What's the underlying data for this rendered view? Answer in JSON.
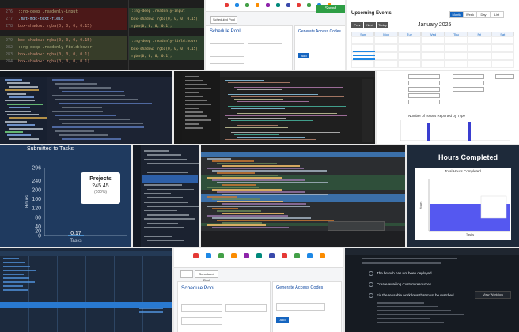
{
  "tile1": {
    "lines": [
      {
        "num": "276",
        "code": "  ::ng-deep .readonly-input",
        "color": "#b0b080"
      },
      {
        "num": "277",
        "code": "    .mat-mdc-text-field",
        "color": "#9cdcfe"
      },
      {
        "num": "278",
        "code": "      box-shadow: rgba(0, 0, 0, 0.15)",
        "color": "#ce9178"
      },
      {
        "num": "279",
        "code": "      box-shadow: rgba(0, 0, 0, 0.15)",
        "color": "#ce9178"
      },
      {
        "num": "282",
        "code": "  ::ng-deep .readonly-field:hover",
        "color": "#b0b080"
      },
      {
        "num": "283",
        "code": "      box-shadow: rgba(0, 0, 0, 0.1)",
        "color": "#ce9178"
      },
      {
        "num": "284",
        "code": "      box-shadow: rgba(0, 0, 0, 0.1)",
        "color": "#ce9178"
      }
    ],
    "right_lines": [
      "  ::ng-deep .readonly-input",
      "    box-shadow: rgba(0, 0, 0, 0.15),",
      "      rgba(0, 0, 0, 0.1);",
      "",
      "  ::ng-deep .readonly-field:hover",
      "    box-shadow: rgba(0, 0, 0, 0.15),",
      "      rgba(0, 0, 0, 0.1);"
    ]
  },
  "tile2": {
    "tab_label": "Scheduled Pool",
    "left_heading": "Schedule Pool",
    "right_heading": "Generate Access Codes",
    "button_label": "Add",
    "toast": "Saved"
  },
  "tile3": {
    "title": "Upcoming Events",
    "month": "January 2025",
    "view_buttons": [
      "Month",
      "Week",
      "Day",
      "List"
    ],
    "nav_buttons": [
      "Prev",
      "Next",
      "Today"
    ],
    "weekdays": [
      "Sun",
      "Mon",
      "Tue",
      "Wed",
      "Thu",
      "Fri",
      "Sat"
    ]
  },
  "tile7": {
    "chart_title": "Number of Issues Reported by Type"
  },
  "tile8": {
    "header": "Submitted to Tasks",
    "ylabel": "Hours",
    "xlabel": "Tasks",
    "tooltip": {
      "label": "Projects",
      "value": "245.45",
      "pct": "(100%)"
    },
    "bar_label": "0.17",
    "chart_data": {
      "type": "bar",
      "categories": [
        "Tasks"
      ],
      "values": [
        0.17
      ],
      "xlabel": "Tasks",
      "ylabel": "Hours",
      "ylim": [
        0,
        296
      ],
      "yticks": [
        296,
        240,
        200,
        160,
        120,
        80,
        40,
        20,
        0
      ]
    }
  },
  "tile11": {
    "title": "Hours Completed",
    "subtitle": "Total Hours Completed",
    "chart_data": {
      "type": "bar",
      "categories": [
        "Tasks"
      ],
      "values": [
        40
      ],
      "xlabel": "Tasks",
      "ylabel": "Hours"
    }
  },
  "tile13": {
    "tab_label": "Scheduled Pool",
    "left_heading": "Schedule Pool",
    "right_heading": "Generate Access Codes",
    "button_label": "Add"
  },
  "tile14": {
    "items": [
      "The branch has not been deployed",
      "Create awaiting Custom resources",
      "Fix the reusable workflows that must be matched"
    ],
    "button_label": "View Workflow"
  },
  "colors": {
    "accent_blue": "#1565c0",
    "chart_blue": "#5558f0",
    "green": "#2e9e45",
    "dark": "#1e1e1e"
  }
}
